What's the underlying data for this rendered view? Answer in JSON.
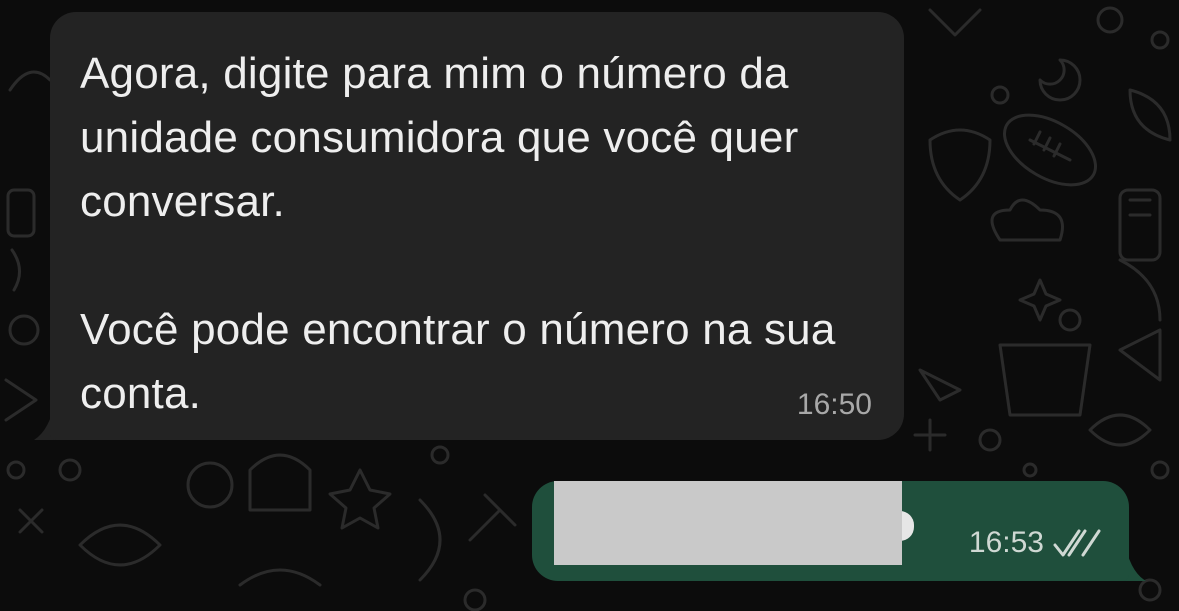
{
  "chat": {
    "incoming": {
      "paragraph1": "Agora, digite para mim o número da unidade consumidora que você quer conversar.",
      "paragraph2": "Você pode encontrar o número na sua conta.",
      "time": "16:50"
    },
    "outgoing": {
      "text_redacted": true,
      "time": "16:53",
      "status_icon": "double-check-icon"
    }
  },
  "colors": {
    "background": "#0c0c0c",
    "incoming_bubble": "#232323",
    "outgoing_bubble": "#1f4f3c",
    "text": "#eeeeee",
    "timestamp": "#a8a8a8"
  }
}
